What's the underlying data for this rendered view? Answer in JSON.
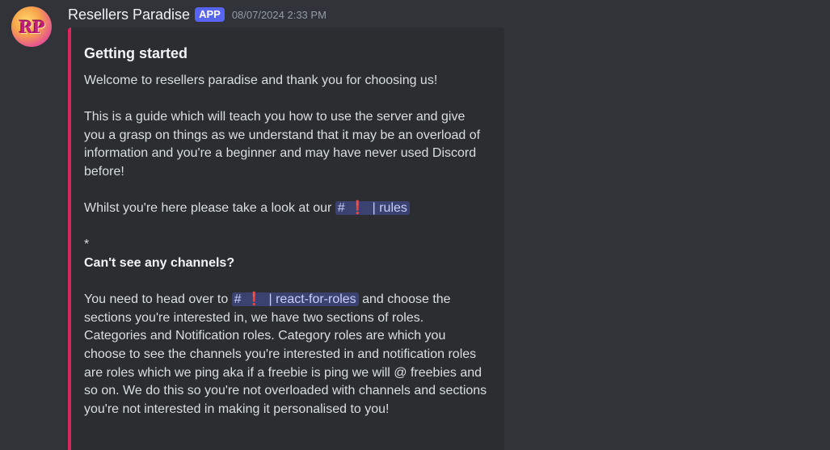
{
  "message": {
    "author": "Resellers Paradise",
    "badge": "APP",
    "timestamp": "08/07/2024 2:33 PM",
    "avatar_letters": "RP"
  },
  "embed": {
    "accent_color": "#e0245e",
    "title": "Getting started",
    "welcome": "Welcome to resellers paradise and thank you for choosing us!",
    "guide": "This is a guide which will teach you how to use the server and give you a grasp on things as we understand that it may be an overload of information and you're a beginner and may have never used Discord before!",
    "rules_prefix": "Whilst you're here please take a look at our ",
    "rules_channel": "| rules",
    "asterisk": "*",
    "subheading": "Can't see any channels?",
    "roles_prefix": "You need to head over to ",
    "roles_channel": "| react-for-roles",
    "roles_text": " and choose the sections you're interested in, we have two sections of roles. Categories and Notification roles. Category roles are which you choose to see the channels you're interested in and notification roles are roles which we ping aka if a freebie is ping we will @ freebies and so on. We do this so you're not overloaded with channels and sections you're not interested in making it personalised to you!"
  },
  "icons": {
    "hash": "#",
    "exclamation": "❗"
  }
}
